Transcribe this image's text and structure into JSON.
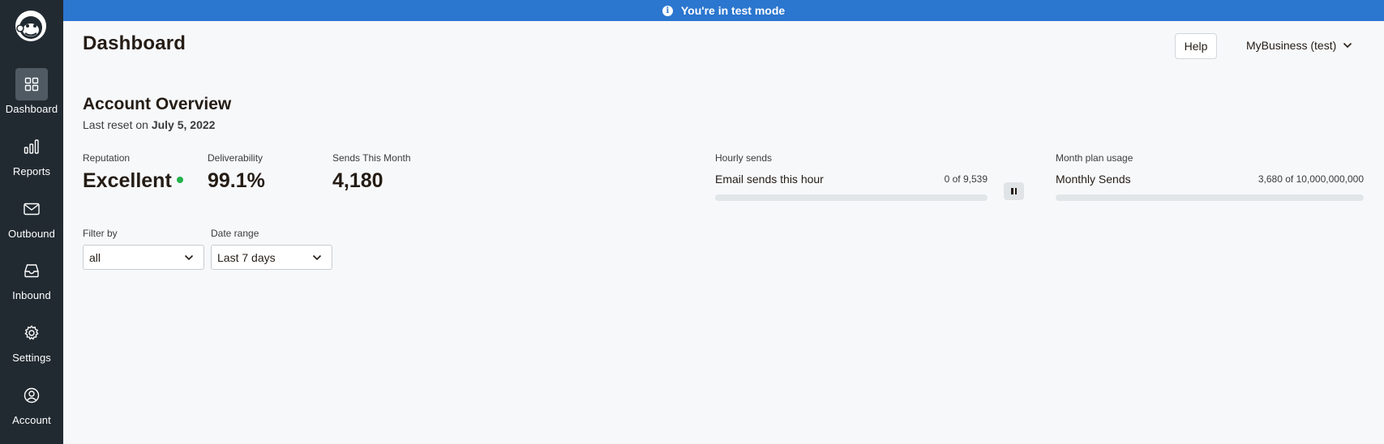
{
  "sidebar": {
    "logo_icon": "mailchimp-freddie-logo",
    "items": [
      {
        "label": "Dashboard",
        "icon": "grid-icon",
        "active": true
      },
      {
        "label": "Reports",
        "icon": "bar-chart-icon"
      },
      {
        "label": "Outbound",
        "icon": "envelope-icon"
      },
      {
        "label": "Inbound",
        "icon": "inbox-icon"
      },
      {
        "label": "Settings",
        "icon": "gear-icon"
      },
      {
        "label": "Account",
        "icon": "user-circle-icon"
      }
    ]
  },
  "banner": {
    "text": "You're in test mode",
    "icon": "info-icon",
    "color": "#2b76cf"
  },
  "header": {
    "title": "Dashboard",
    "help_label": "Help",
    "account_label": "MyBusiness (test)"
  },
  "overview": {
    "title": "Account Overview",
    "reset_prefix": "Last reset on ",
    "reset_date": "July 5, 2022"
  },
  "stats": {
    "reputation": {
      "label": "Reputation",
      "value": "Excellent",
      "status_color": "#22b24c"
    },
    "deliverability": {
      "label": "Deliverability",
      "value": "99.1%"
    },
    "sends": {
      "label": "Sends This Month",
      "value": "4,180"
    }
  },
  "hourly": {
    "label": "Hourly sends",
    "title": "Email sends this hour",
    "count": "0 of 9,539",
    "progress": 0
  },
  "monthly": {
    "label": "Month plan usage",
    "title": "Monthly Sends",
    "count": "3,680 of 10,000,000,000",
    "progress": 3.68e-07
  },
  "filters": {
    "filter_label": "Filter by",
    "filter_value": "all",
    "range_label": "Date range",
    "range_value": "Last 7 days"
  }
}
